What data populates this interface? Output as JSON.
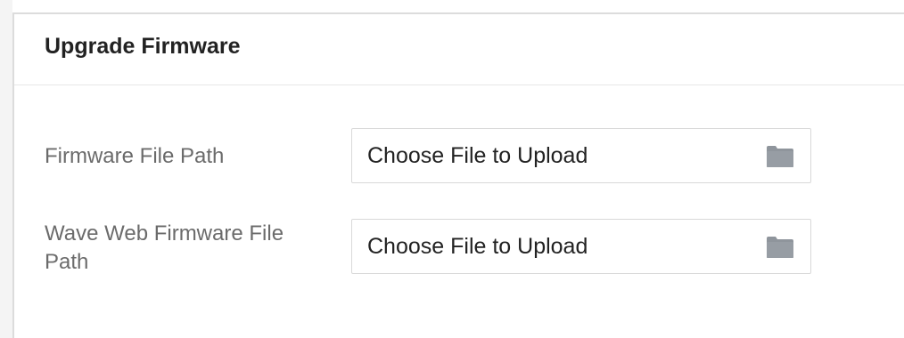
{
  "panel": {
    "title": "Upgrade Firmware"
  },
  "fields": [
    {
      "label": "Firmware File Path",
      "value": "Choose File to Upload",
      "icon": "folder-icon"
    },
    {
      "label": "Wave Web Firmware File Path",
      "value": "Choose File to Upload",
      "icon": "folder-icon"
    }
  ],
  "colors": {
    "title_text": "#222222",
    "label_text": "#6b6b6b",
    "border": "#d9d9d9",
    "icon": "#8f959c"
  }
}
